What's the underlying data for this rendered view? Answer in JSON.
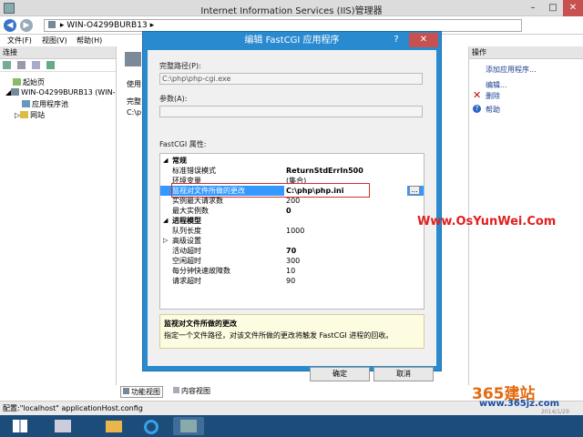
{
  "window": {
    "title": "Internet Information Services (IIS)管理器",
    "address": "WIN-O4299BURB13",
    "minimize": "–",
    "maximize": "□",
    "close": "✕"
  },
  "menu": {
    "file": "文件(F)",
    "view": "视图(V)",
    "help": "帮助(H)"
  },
  "left": {
    "header": "连接",
    "tree": [
      {
        "label": "起始页"
      },
      {
        "label": "WIN-O4299BURB13 (WIN-"
      },
      {
        "label": "应用程序池"
      },
      {
        "label": "网站"
      }
    ]
  },
  "middle": {
    "label_use": "使用",
    "label_full": "完整",
    "label_path": "C:\\p"
  },
  "actions": {
    "header": "操作",
    "add": "添加应用程序...",
    "edit": "编辑...",
    "delete": "删除",
    "help": "帮助"
  },
  "dialog": {
    "title": "编辑 FastCGI 应用程序",
    "help": "?",
    "close": "✕",
    "full_path_label": "完整路径(P):",
    "full_path_value": "C:\\php\\php-cgi.exe",
    "args_label": "参数(A):",
    "args_value": "",
    "props_label": "FastCGI 属性:",
    "groups": {
      "general": "常规",
      "process": "进程模型"
    },
    "props": [
      {
        "name": "标准错误模式",
        "value": "ReturnStdErrIn500"
      },
      {
        "name": "环境变量",
        "value": "(集合)"
      },
      {
        "name": "监视对文件所做的更改",
        "value": "C:\\php\\php.ini"
      },
      {
        "name": "实例最大请求数",
        "value": "200"
      },
      {
        "name": "最大实例数",
        "value": "0"
      },
      {
        "name": "队列长度",
        "value": "1000"
      },
      {
        "name": "高级设置",
        "value": ""
      },
      {
        "name": "活动超时",
        "value": "70"
      },
      {
        "name": "空闲超时",
        "value": "300"
      },
      {
        "name": "每分钟快速故障数",
        "value": "10"
      },
      {
        "name": "请求超时",
        "value": "90"
      }
    ],
    "desc_title": "监视对文件所做的更改",
    "desc_text": "指定一个文件路径，对该文件所做的更改将触发 FastCGI 进程的回收。",
    "ok": "确定",
    "cancel": "取消",
    "browse": "..."
  },
  "bottom": {
    "features_view": "功能视图",
    "content_view": "内容视图"
  },
  "status": "配置:\"localhost\" applicationHost.config",
  "watermark": "Www.OsYunWei.Com",
  "logo": {
    "text": "365建站",
    "url": "www.365jz.com",
    "date": "2014/1/29"
  }
}
